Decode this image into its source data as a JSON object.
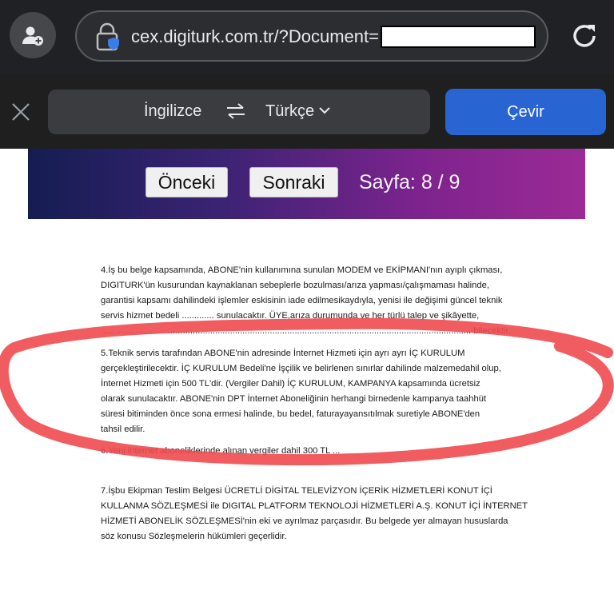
{
  "browser": {
    "url": "cex.digiturk.com.tr/?Document=",
    "icons": [
      "profile-add-icon",
      "lock-shield-icon",
      "reload-icon"
    ]
  },
  "translate_bar": {
    "source_lang": "İngilizce",
    "target_lang": "Türkçe",
    "translate_label": "Çevir",
    "icons": [
      "close-icon",
      "swap-icon",
      "chevron-down-icon"
    ],
    "accent": "#2864d2"
  },
  "pager": {
    "prev_label": "Önceki",
    "next_label": "Sonraki",
    "page_text": "Sayfa: 8 / 9"
  },
  "document": {
    "para4": [
      "4.İş bu belge kapsamında, ABONE'nin kullanımına sunulan MODEM ve EKİPMANI'nın ayıplı çıkması,",
      "DIGITURK'ün kusurundan kaynaklanan sebeplerle bozulması/arıza yapması/çalışmaması halinde,",
      "garantisi kapsamı dahilindeki işlemler eskisinin iade edilmesikaydıyla, yenisi ile değişimi güncel teknik",
      "servis hizmet bedeli ............. sunulacaktır. ÜYE,arıza durumunda ve her türlü talep ve şikâyette,",
      "..................................................................................................................................................... bilecektir."
    ],
    "para5": [
      "5.Teknik servis tarafından ABONE'nin adresinde İnternet Hizmeti için ayrı ayrı İÇ KURULUM",
      "gerçekleştirilecektir. İÇ KURULUM Bedeli'ne İşçilik ve belirlenen sınırlar dahilinde malzemedahil olup,",
      "İnternet Hizmeti için 500 TL'dir. (Vergiler Dahil) İÇ KURULUM, KAMPANYA kapsamında ücretsiz",
      "olarak sunulacaktır. ABONE'nin DPT İnternet Aboneliğinin herhangi birnedenle kampanya taahhüt",
      "süresi bitiminden önce sona ermesi halinde, bu bedel, faturayayansıtılmak suretiyle ABONE'den",
      "tahsil edilir."
    ],
    "para6": [
      "6.Yeni internet aboneliklerinde alınan vergiler dahil 300 TL ..."
    ],
    "para7": [
      "7.İşbu Ekipman Teslim Belgesi ÜCRETLİ DİGİTAL TELEVİZYON İÇERİK HİZMETLERİ KONUT İÇİ",
      "KULLANMA SÖZLEŞMESİ ile DIGITAL PLATFORM TEKNOLOJİ HİZMETLERİ A.Ş. KONUT İÇİ İNTERNET",
      "HİZMETİ ABONELİK SÖZLEŞMESİ'nin eki ve ayrılmaz parçasıdır. Bu belgede yer almayan hususlarda",
      "söz konusu Sözleşmelerin hükümleri geçerlidir."
    ]
  },
  "annotation": {
    "color": "#ef4a4f"
  }
}
